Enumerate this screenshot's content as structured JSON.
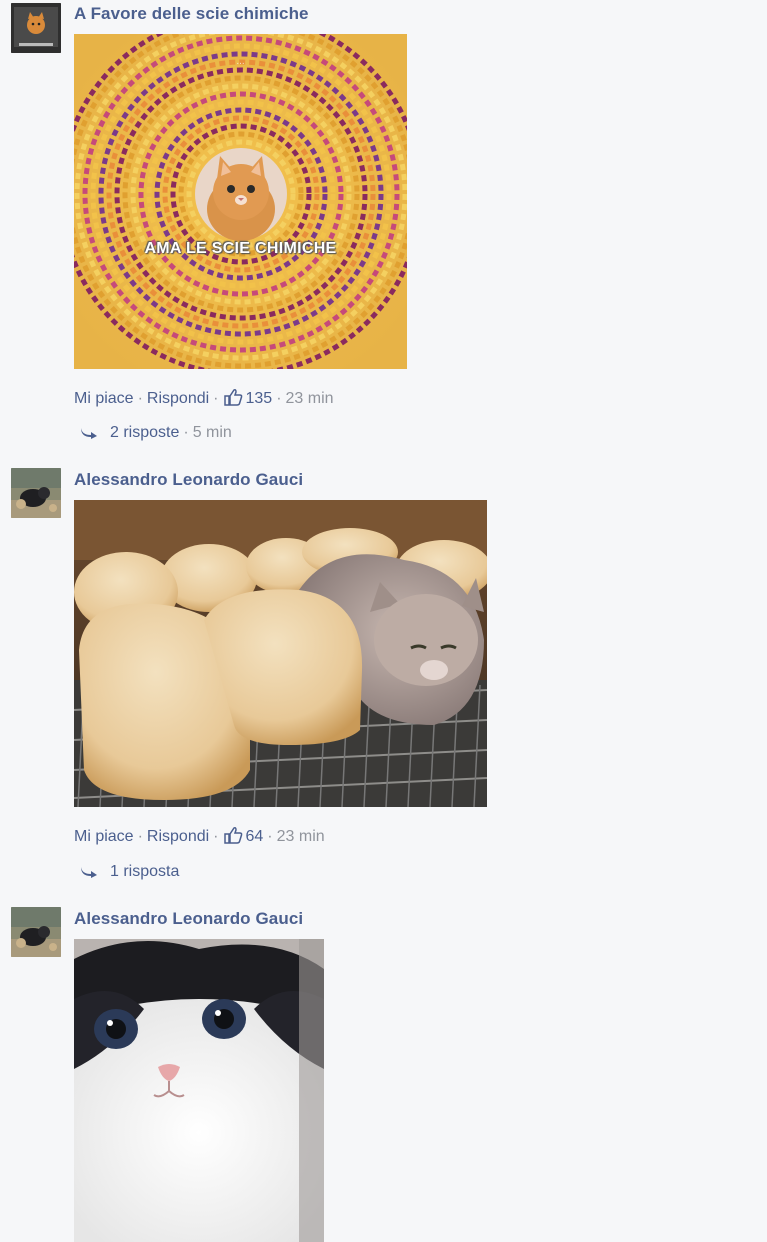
{
  "comments": [
    {
      "author": "A Favore delle scie chimiche",
      "avatar_icon": "orange-cat-avatar-icon",
      "image_caption": "AMA LE SCIE CHIMICHE",
      "image_watermark": "...",
      "like_label": "Mi piace",
      "reply_label": "Rispondi",
      "like_count": "135",
      "time": "23 min",
      "replies_label": "2 risposte",
      "replies_time": "5 min"
    },
    {
      "author": "Alessandro Leonardo Gauci",
      "avatar_icon": "cat-avatar-icon",
      "like_label": "Mi piace",
      "reply_label": "Rispondi",
      "like_count": "64",
      "time": "23 min",
      "replies_label": "1 risposta"
    },
    {
      "author": "Alessandro Leonardo Gauci",
      "avatar_icon": "cat-avatar-icon"
    }
  ],
  "colors": {
    "link": "#4b5f8e",
    "meta": "#90949c",
    "background": "#f6f7f9"
  }
}
